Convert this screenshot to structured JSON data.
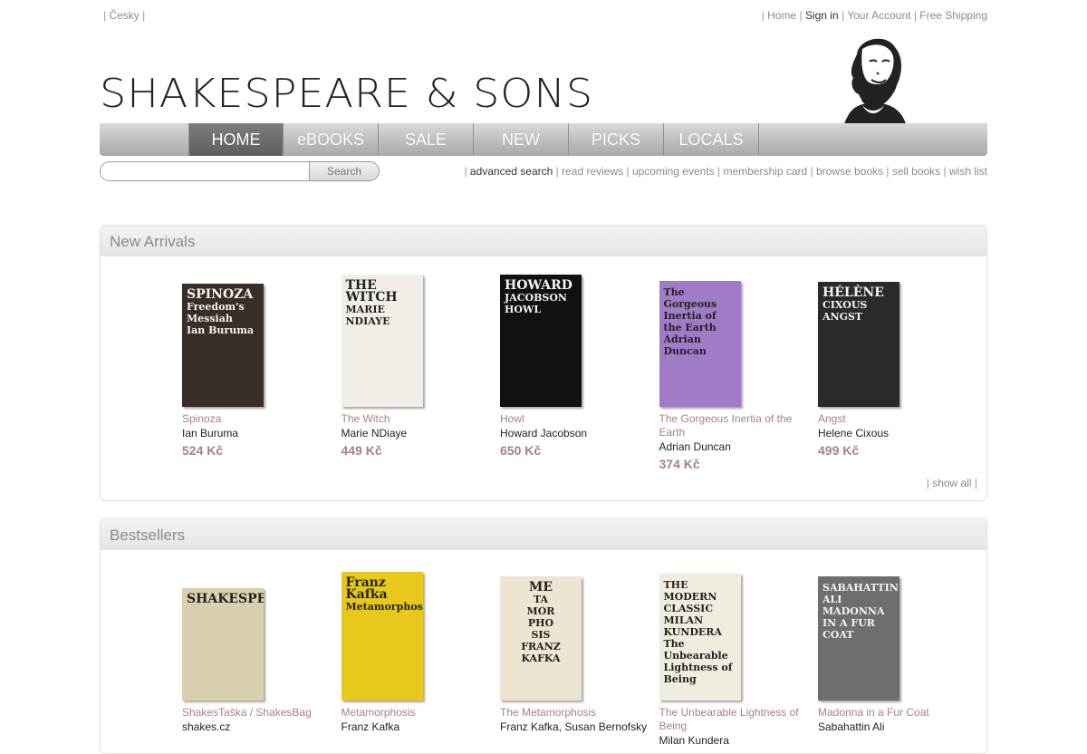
{
  "top_left": {
    "language": "Česky"
  },
  "top_right": {
    "home": "Home",
    "sign_in": "Sign in",
    "account": "Your Account",
    "shipping": "Free Shipping"
  },
  "logo": {
    "text": "SHAKESPEARE & SONS"
  },
  "nav": [
    "HOME",
    "eBOOKS",
    "SALE",
    "NEW",
    "PICKS",
    "LOCALS"
  ],
  "search": {
    "placeholder": "",
    "button": "Search"
  },
  "sub_links": [
    "advanced search",
    "read reviews",
    "upcoming events",
    "membership card",
    "browse books",
    "sell books",
    "wish list"
  ],
  "new_arrivals": {
    "title": "New Arrivals",
    "show_all": "show all",
    "items": [
      {
        "title": "Spinoza",
        "author": "Ian Buruma",
        "price": "524 Kč",
        "cover": {
          "bg": "#3a2f28",
          "lines": [
            "SPINOZA",
            "Freedom's Messiah",
            "Ian Buruma"
          ]
        }
      },
      {
        "title": "The Witch",
        "author": "Marie NDiaye",
        "price": "449 Kč",
        "cover": {
          "bg": "#f2ede6",
          "lines": [
            "THE WITCH",
            "MARIE NDIAYE"
          ]
        }
      },
      {
        "title": "Howl",
        "author": "Howard Jacobson",
        "price": "650 Kč",
        "cover": {
          "bg": "#111111",
          "lines": [
            "HOWARD",
            "JACOBSON",
            "HOWL"
          ]
        }
      },
      {
        "title": "The Gorgeous Inertia of the Earth",
        "author": "Adrian Duncan",
        "price": "374 Kč",
        "cover": {
          "bg": "#a07cc8",
          "lines": [
            "The Gorgeous",
            "Inertia of the Earth",
            "Adrian Duncan"
          ]
        }
      },
      {
        "title": "Angst",
        "author": "Helene Cixous",
        "price": "499 Kč",
        "cover": {
          "bg": "#2a2a2a",
          "lines": [
            "HÉLÈNE",
            "CIXOUS",
            "ANGST"
          ]
        }
      }
    ]
  },
  "bestsellers": {
    "title": "Bestsellers",
    "items": [
      {
        "title": "ShakesTaška / ShakesBag",
        "author": "shakes.cz",
        "cover": {
          "bg": "#d8cfae",
          "lines": [
            "SHAKESPEARE"
          ]
        }
      },
      {
        "title": "Metamorphosis",
        "author": "Franz Kafka",
        "cover": {
          "bg": "#e8c81c",
          "lines": [
            "Franz Kafka",
            "Metamorphosis"
          ]
        }
      },
      {
        "title": "The Metamorphosis",
        "author": "Franz Kafka, Susan Bernofsky",
        "cover": {
          "bg": "#ede4d1",
          "lines": [
            "ME",
            "TA",
            "MOR",
            "PHO",
            "SIS",
            "FRANZ KAFKA"
          ]
        }
      },
      {
        "title": "The Unbearable Lightness of Being",
        "author": "Milan Kundera",
        "cover": {
          "bg": "#f1ece0",
          "lines": [
            "THE MODERN CLASSIC",
            "MILAN",
            "KUNDERA",
            "The Unbearable",
            "Lightness of",
            "Being"
          ]
        }
      },
      {
        "title": "Madonna in a Fur Coat",
        "author": "Sabahattin Ali",
        "cover": {
          "bg": "#6e6e6e",
          "lines": [
            "SABAHATTIN ALI",
            "MADONNA IN A FUR COAT"
          ]
        }
      }
    ]
  }
}
